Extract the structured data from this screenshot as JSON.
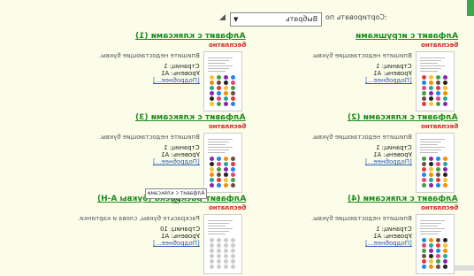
{
  "sort": {
    "label": ":Сортировать по",
    "value": "Выбрать"
  },
  "cards": [
    {
      "title": "Алфавит с игрушками",
      "price": "бесплатно",
      "desc": "Впишите недостающие буквы.",
      "pages": "Страниц: 1",
      "level": "Уровень: A1",
      "more": "[Подробнее...]"
    },
    {
      "title": "Алфавит с кляксами (1)",
      "price": "бесплатно",
      "desc": "Впишите недостающие буквы.",
      "pages": "Страниц: 1",
      "level": "Уровень: A1",
      "more": "[Подробнее...]"
    },
    {
      "title": "Алфавит с кляксами (2)",
      "price": "бесплатно",
      "desc": "Впишите недостающие буквы.",
      "pages": "Страниц: 1",
      "level": "Уровень: A1",
      "more": "[Подробнее...]"
    },
    {
      "title": "Алфавит с кляксами (3)",
      "price": "бесплатно",
      "desc": "Впишите недостающие буквы.",
      "pages": "Страниц: 1",
      "level": "Уровень: A1",
      "more": "[Подробнее...]"
    },
    {
      "title": "Алфавит с кляксами (4)",
      "price": "бесплатно",
      "desc": "Впишите недостающие буквы.",
      "pages": "Страниц: 1",
      "level": "Уровень: A1",
      "more": "[Подробнее...]"
    },
    {
      "title": "Алфавит-раскраска (буквы А-Н)",
      "price": "бесплатно",
      "desc": "Раскрасьте буквы, слова и картинки.",
      "pages": "Страниц: 10",
      "level": "Уровень: A1",
      "more": "[Подробнее...]"
    }
  ],
  "tooltip": "Алфавит с кляксами (3)",
  "colors": {
    "title": "#1d8b1d",
    "price": "#cc2222",
    "link": "#2a5db0",
    "background": "#fbfde9"
  }
}
